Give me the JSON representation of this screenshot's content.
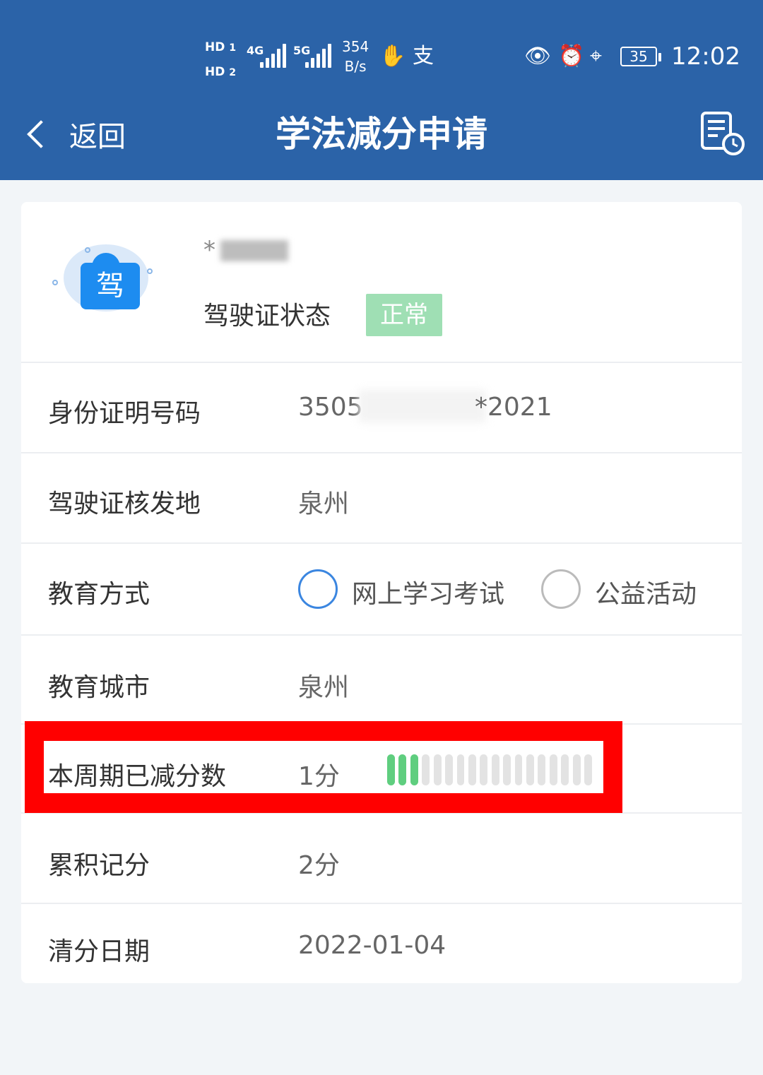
{
  "status_bar": {
    "hd1": "HD",
    "hd1_sub": "1",
    "hd2": "HD",
    "hd2_sub": "2",
    "net1": "4G",
    "net2": "5G",
    "speed_value": "354",
    "speed_unit": "B/s",
    "battery": "35",
    "time": "12:02",
    "icons": [
      "hand-stop-icon",
      "alipay-icon",
      "eye-icon",
      "alarm-icon",
      "location-icon"
    ]
  },
  "header": {
    "back_label": "返回",
    "title": "学法减分申请",
    "record_icon": "document-clock-icon"
  },
  "profile": {
    "name_masked": "*",
    "license_status_label": "驾驶证状态",
    "license_status_value": "正常",
    "badge_text": "驾"
  },
  "rows": {
    "id_number": {
      "label": "身份证明号码",
      "value_prefix": "3505",
      "value_suffix": "*2021"
    },
    "issue_place": {
      "label": "驾驶证核发地",
      "value": "泉州"
    },
    "education_mode": {
      "label": "教育方式",
      "options": [
        "网上学习考试",
        "公益活动"
      ]
    },
    "education_city": {
      "label": "教育城市",
      "value": "泉州"
    },
    "deducted": {
      "label": "本周期已减分数",
      "value": "1分",
      "meter_filled": 3,
      "meter_total": 18
    },
    "accumulated": {
      "label": "累积记分",
      "value": "2分"
    },
    "clear_date": {
      "label": "清分日期",
      "value": "2022-01-04"
    }
  },
  "colors": {
    "header_bg": "#2b63a8",
    "status_tag_bg": "#9fdfb4",
    "highlight": "#ff0000",
    "meter_on": "#5fce7f",
    "radio_selected": "#3b86e0"
  }
}
